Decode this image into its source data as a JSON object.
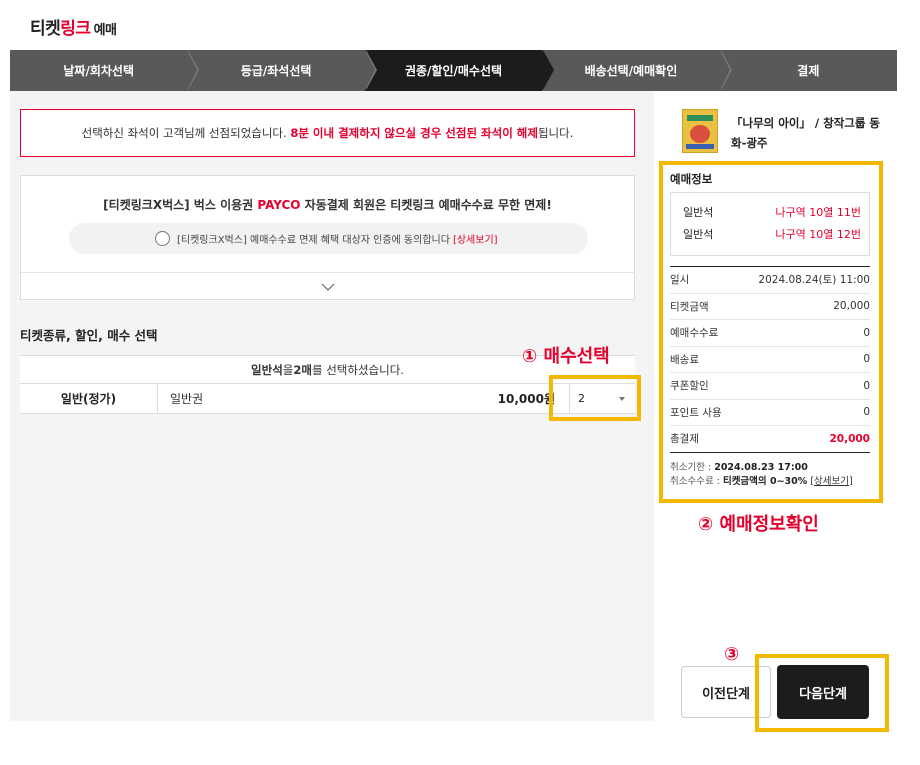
{
  "header": {
    "logo_part1": "티켓",
    "logo_part2": "링크",
    "logo_sub": "예매"
  },
  "steps": [
    {
      "label": "날짜/회차선택",
      "active": false
    },
    {
      "label": "등급/좌석선택",
      "active": false
    },
    {
      "label": "권종/할인/매수선택",
      "active": true
    },
    {
      "label": "배송선택/예매확인",
      "active": false
    },
    {
      "label": "결제",
      "active": false
    }
  ],
  "notice": {
    "text_before": "선택하신 좌석이 고객님께 선점되었습니다. ",
    "text_highlight": "8분 이내 결제하지 않으실 경우 선점된 좌석이 해제",
    "text_after": "됩니다."
  },
  "promo": {
    "title_before": "[티켓링크X벅스] 벅스 이용권 ",
    "title_payco": "PAYCO",
    "title_after": " 자동결제 회원은 티켓링크 예매수수료 무한 면제!",
    "agree_text": "[티켓링크X벅스] 예매수수료 면제 혜택 대상자 인증에 동의합니다",
    "more_link": "[상세보기]"
  },
  "ticket_section": {
    "title": "티켓종류, 할인, 매수 선택",
    "msg_grade": "일반석",
    "msg_mid": "을 ",
    "msg_count": "2매",
    "msg_end": "를 선택하셨습니다.",
    "row": {
      "type": "일반(정가)",
      "name": "일반권",
      "price": "10,000원",
      "quantity": "2"
    }
  },
  "annotations": {
    "a1": "① 매수선택",
    "a2": "② 예매정보확인",
    "a3": "③"
  },
  "sidebar": {
    "show_title": "「나무의 아이」 / 창작그룹 동화-광주",
    "info_title": "예매정보",
    "seats": [
      {
        "grade": "일반석",
        "seat": "나구역 10열 11번"
      },
      {
        "grade": "일반석",
        "seat": "나구역 10열 12번"
      }
    ],
    "rows": [
      {
        "label": "일시",
        "value": "2024.08.24(토) 11:00"
      },
      {
        "label": "티켓금액",
        "value": "20,000"
      },
      {
        "label": "예매수수료",
        "value": "0"
      },
      {
        "label": "배송료",
        "value": "0"
      },
      {
        "label": "쿠폰할인",
        "value": "0"
      },
      {
        "label": "포인트 사용",
        "value": "0"
      }
    ],
    "total_label": "총결제",
    "total_value": "20,000",
    "cancel_deadline_label": "취소기한 : ",
    "cancel_deadline_value": "2024.08.23 17:00",
    "cancel_fee_label": "취소수수료 : ",
    "cancel_fee_value": "티켓금액의 0~30%",
    "cancel_more": "[상세보기]",
    "prev_button": "이전단계",
    "next_button": "다음단계"
  },
  "colors": {
    "accent_red": "#e6002d",
    "highlight_yellow": "#f5b800",
    "step_active": "#1c1c1c",
    "step_inactive": "#595959"
  }
}
